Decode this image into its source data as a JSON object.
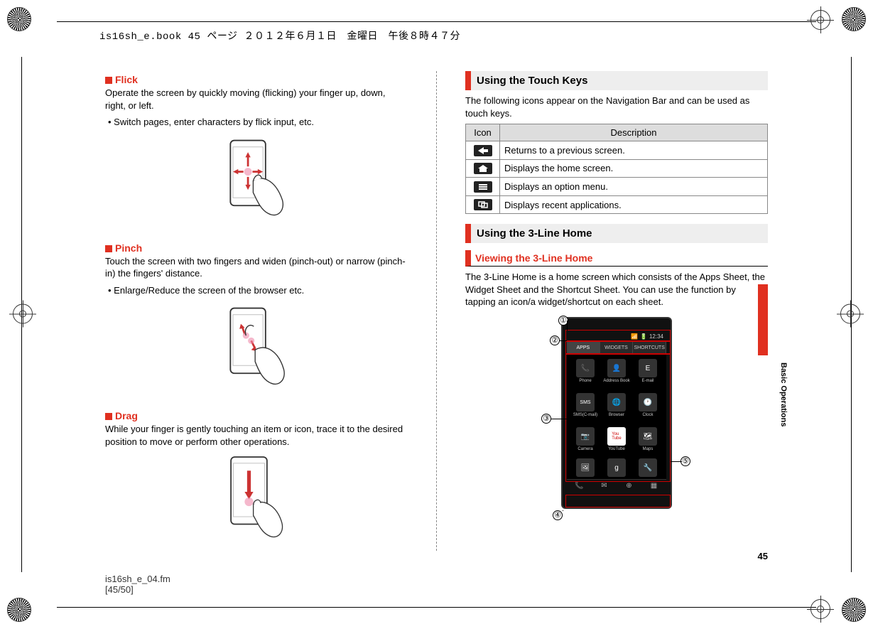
{
  "book_header": "is16sh_e.book  45 ページ  ２０１２年６月１日　金曜日　午後８時４７分",
  "side_label": "Basic Operations",
  "page_number": "45",
  "footer": {
    "line1": "is16sh_e_04.fm",
    "line2": "[45/50]"
  },
  "left": {
    "flick": {
      "title": "Flick",
      "para": "Operate the screen by quickly moving (flicking) your finger up, down, right, or left.",
      "bullet": "Switch pages, enter characters by flick input, etc."
    },
    "pinch": {
      "title": "Pinch",
      "para": "Touch the screen with two fingers and widen (pinch-out) or narrow (pinch-in) the fingers' distance.",
      "bullet": "Enlarge/Reduce the screen of the browser etc."
    },
    "drag": {
      "title": "Drag",
      "para": "While your finger is gently touching an item or icon, trace it to the desired position to move or perform other operations."
    }
  },
  "right": {
    "touch_keys_heading": "Using the Touch Keys",
    "touch_keys_intro": "The following icons appear on the Navigation Bar and can be used as touch keys.",
    "table": {
      "head_icon": "Icon",
      "head_desc": "Description",
      "rows": [
        {
          "icon": "back",
          "desc": "Returns to a previous screen."
        },
        {
          "icon": "home",
          "desc": "Displays the home screen."
        },
        {
          "icon": "menu",
          "desc": "Displays an option menu."
        },
        {
          "icon": "recent",
          "desc": "Displays recent applications."
        }
      ]
    },
    "three_line_heading": "Using the 3-Line Home",
    "view_heading": "Viewing the 3-Line Home",
    "view_para": "The 3-Line Home is a home screen which consists of the Apps Sheet, the Widget Sheet and the Shortcut Sheet. You can use the function by tapping an icon/a widget/shortcut on each sheet.",
    "status_time": "12:34",
    "tabs": {
      "apps": "APPS",
      "widgets": "WIDGETS",
      "shortcuts": "SHORTCUTS"
    },
    "apps": {
      "phone": "Phone",
      "address": "Address Book",
      "email": "E-mail",
      "sms": "SMS(C-mail)",
      "browser": "Browser",
      "clock": "Clock",
      "camera": "Camera",
      "youtube": "YouTube",
      "maps": "Maps"
    },
    "callouts": {
      "c1": "①",
      "c2": "②",
      "c3": "③",
      "c4": "④",
      "c5": "⑤"
    }
  }
}
